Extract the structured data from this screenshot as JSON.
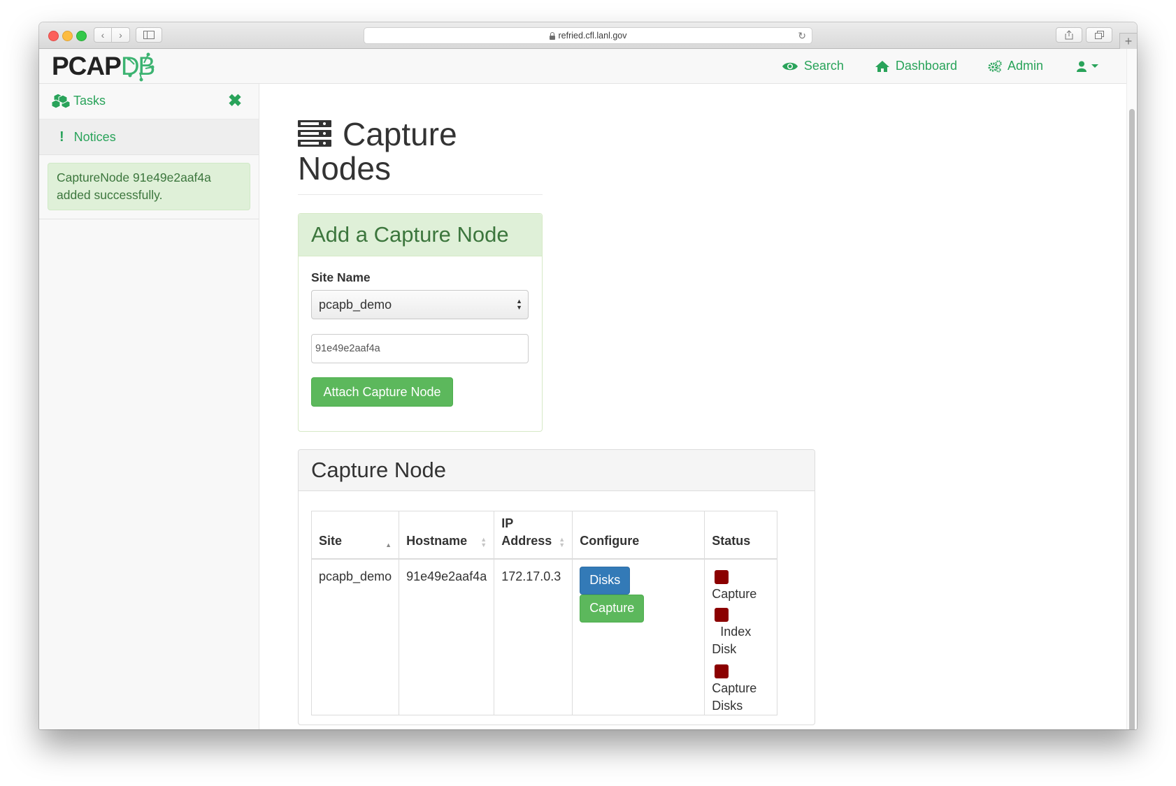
{
  "browser": {
    "url": "refried.cfl.lanl.gov"
  },
  "navbar": {
    "logo_main": "PCAP",
    "logo_accent": "DB",
    "links": [
      {
        "label": "Search",
        "icon": "eye-icon"
      },
      {
        "label": "Dashboard",
        "icon": "home-icon"
      },
      {
        "label": "Admin",
        "icon": "gears-icon"
      }
    ],
    "user_icon": "user-icon"
  },
  "sidebar": {
    "tasks_label": "Tasks",
    "notices_label": "Notices",
    "notice_message": "CaptureNode 91e49e2aaf4a added successfully."
  },
  "page": {
    "title": "Capture Nodes"
  },
  "add_panel": {
    "heading": "Add a Capture Node",
    "site_label": "Site Name",
    "site_value": "pcapb_demo",
    "host_placeholder": "91e49e2aaf4a",
    "attach_button": "Attach Capture Node"
  },
  "nodes_panel": {
    "heading": "Capture Node",
    "columns": [
      "Site",
      "Hostname",
      "IP Address",
      "Configure",
      "Status"
    ],
    "rows": [
      {
        "site": "pcapb_demo",
        "hostname": "91e49e2aaf4a",
        "ip": "172.17.0.3",
        "configure": [
          "Disks",
          "Capture"
        ],
        "status": [
          "Capture",
          "Index Disk",
          "Capture Disks"
        ]
      }
    ]
  },
  "colors": {
    "accent_green": "#29a35a",
    "status_bad": "#8b0000",
    "success_button": "#5cb85c",
    "primary_button": "#337ab7"
  }
}
